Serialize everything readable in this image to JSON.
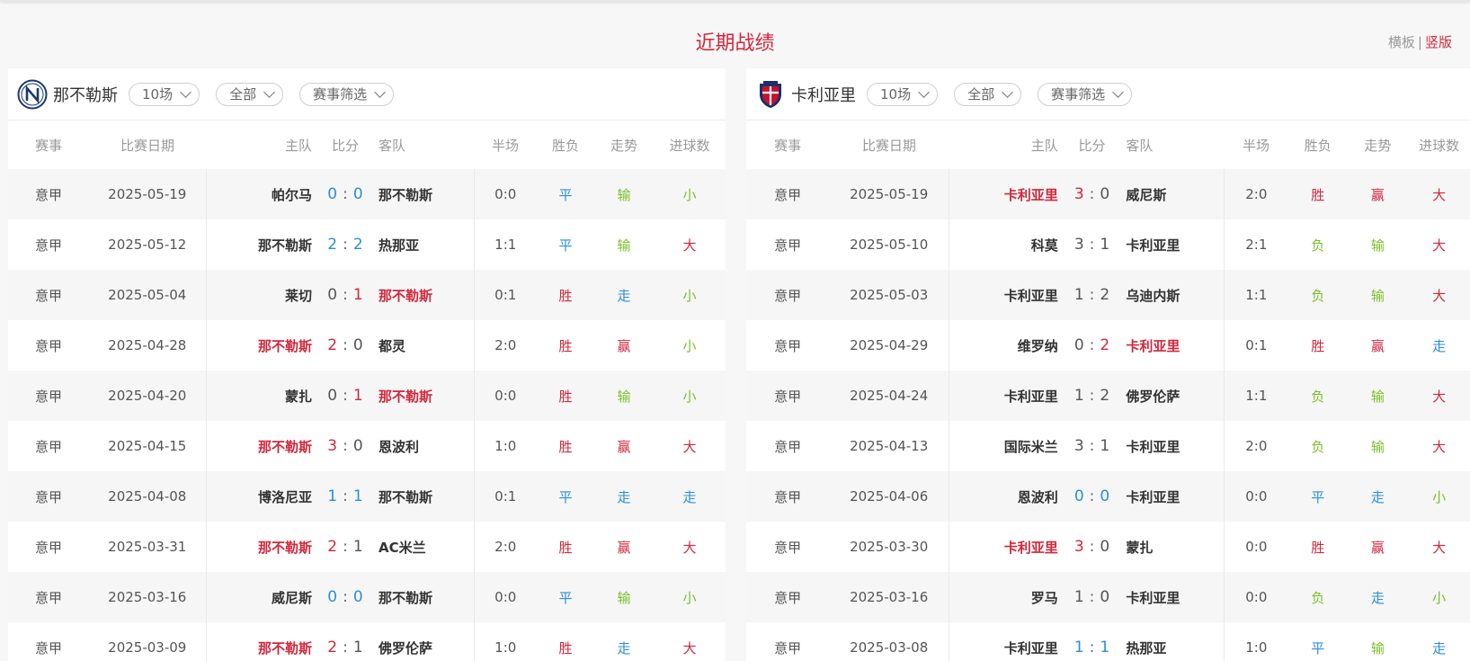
{
  "title": "近期战绩",
  "view": {
    "option1": "横板",
    "separator": "|",
    "option2": "竖版"
  },
  "headers": {
    "league": "赛事",
    "date": "比赛日期",
    "home": "主队",
    "score": "比分",
    "away": "客队",
    "half": "半场",
    "result": "胜负",
    "trend": "走势",
    "goals": "进球数"
  },
  "colors": {
    "win": "#d0283c",
    "draw": "#2a8fd8",
    "lose": "#7bbf2a",
    "neutral": "#555555"
  },
  "panels": [
    {
      "team": "那不勒斯",
      "logo_icon": "napoli-logo-icon",
      "filters": [
        "10场",
        "全部",
        "赛事筛选"
      ],
      "rows": [
        {
          "league": "意甲",
          "date": "2025-05-19",
          "home": "帕尔马",
          "hs": "0",
          "as": "0",
          "away": "那不勒斯",
          "half": "0:0",
          "result": "平",
          "trend": "输",
          "goals": "小",
          "hl": "",
          "sc": [
            "blue",
            "blue"
          ],
          "rc": "blue",
          "tc": "green",
          "gc": "green"
        },
        {
          "league": "意甲",
          "date": "2025-05-12",
          "home": "那不勒斯",
          "hs": "2",
          "as": "2",
          "away": "热那亚",
          "half": "1:1",
          "result": "平",
          "trend": "输",
          "goals": "大",
          "hl": "",
          "sc": [
            "blue",
            "blue"
          ],
          "rc": "blue",
          "tc": "green",
          "gc": "red"
        },
        {
          "league": "意甲",
          "date": "2025-05-04",
          "home": "莱切",
          "hs": "0",
          "as": "1",
          "away": "那不勒斯",
          "half": "0:1",
          "result": "胜",
          "trend": "走",
          "goals": "小",
          "hl": "away",
          "sc": [
            "gray",
            "red"
          ],
          "rc": "red",
          "tc": "blue",
          "gc": "green"
        },
        {
          "league": "意甲",
          "date": "2025-04-28",
          "home": "那不勒斯",
          "hs": "2",
          "as": "0",
          "away": "都灵",
          "half": "2:0",
          "result": "胜",
          "trend": "赢",
          "goals": "小",
          "hl": "home",
          "sc": [
            "red",
            "gray"
          ],
          "rc": "red",
          "tc": "red",
          "gc": "green"
        },
        {
          "league": "意甲",
          "date": "2025-04-20",
          "home": "蒙扎",
          "hs": "0",
          "as": "1",
          "away": "那不勒斯",
          "half": "0:0",
          "result": "胜",
          "trend": "输",
          "goals": "小",
          "hl": "away",
          "sc": [
            "gray",
            "red"
          ],
          "rc": "red",
          "tc": "green",
          "gc": "green"
        },
        {
          "league": "意甲",
          "date": "2025-04-15",
          "home": "那不勒斯",
          "hs": "3",
          "as": "0",
          "away": "恩波利",
          "half": "1:0",
          "result": "胜",
          "trend": "赢",
          "goals": "大",
          "hl": "home",
          "sc": [
            "red",
            "gray"
          ],
          "rc": "red",
          "tc": "red",
          "gc": "red"
        },
        {
          "league": "意甲",
          "date": "2025-04-08",
          "home": "博洛尼亚",
          "hs": "1",
          "as": "1",
          "away": "那不勒斯",
          "half": "0:1",
          "result": "平",
          "trend": "走",
          "goals": "走",
          "hl": "",
          "sc": [
            "blue",
            "blue"
          ],
          "rc": "blue",
          "tc": "blue",
          "gc": "blue"
        },
        {
          "league": "意甲",
          "date": "2025-03-31",
          "home": "那不勒斯",
          "hs": "2",
          "as": "1",
          "away": "AC米兰",
          "half": "2:0",
          "result": "胜",
          "trend": "赢",
          "goals": "大",
          "hl": "home",
          "sc": [
            "red",
            "gray"
          ],
          "rc": "red",
          "tc": "red",
          "gc": "red"
        },
        {
          "league": "意甲",
          "date": "2025-03-16",
          "home": "威尼斯",
          "hs": "0",
          "as": "0",
          "away": "那不勒斯",
          "half": "0:0",
          "result": "平",
          "trend": "输",
          "goals": "小",
          "hl": "",
          "sc": [
            "blue",
            "blue"
          ],
          "rc": "blue",
          "tc": "green",
          "gc": "green"
        },
        {
          "league": "意甲",
          "date": "2025-03-09",
          "home": "那不勒斯",
          "hs": "2",
          "as": "1",
          "away": "佛罗伦萨",
          "half": "1:0",
          "result": "胜",
          "trend": "走",
          "goals": "大",
          "hl": "home",
          "sc": [
            "red",
            "gray"
          ],
          "rc": "red",
          "tc": "blue",
          "gc": "red"
        }
      ]
    },
    {
      "team": "卡利亚里",
      "logo_icon": "cagliari-logo-icon",
      "filters": [
        "10场",
        "全部",
        "赛事筛选"
      ],
      "rows": [
        {
          "league": "意甲",
          "date": "2025-05-19",
          "home": "卡利亚里",
          "hs": "3",
          "as": "0",
          "away": "威尼斯",
          "half": "2:0",
          "result": "胜",
          "trend": "赢",
          "goals": "大",
          "hl": "home",
          "sc": [
            "red",
            "gray"
          ],
          "rc": "red",
          "tc": "red",
          "gc": "red"
        },
        {
          "league": "意甲",
          "date": "2025-05-10",
          "home": "科莫",
          "hs": "3",
          "as": "1",
          "away": "卡利亚里",
          "half": "2:1",
          "result": "负",
          "trend": "输",
          "goals": "大",
          "hl": "",
          "sc": [
            "gray",
            "gray"
          ],
          "rc": "green",
          "tc": "green",
          "gc": "red"
        },
        {
          "league": "意甲",
          "date": "2025-05-03",
          "home": "卡利亚里",
          "hs": "1",
          "as": "2",
          "away": "乌迪内斯",
          "half": "1:1",
          "result": "负",
          "trend": "输",
          "goals": "大",
          "hl": "",
          "sc": [
            "gray",
            "gray"
          ],
          "rc": "green",
          "tc": "green",
          "gc": "red"
        },
        {
          "league": "意甲",
          "date": "2025-04-29",
          "home": "维罗纳",
          "hs": "0",
          "as": "2",
          "away": "卡利亚里",
          "half": "0:1",
          "result": "胜",
          "trend": "赢",
          "goals": "走",
          "hl": "away",
          "sc": [
            "gray",
            "red"
          ],
          "rc": "red",
          "tc": "red",
          "gc": "blue"
        },
        {
          "league": "意甲",
          "date": "2025-04-24",
          "home": "卡利亚里",
          "hs": "1",
          "as": "2",
          "away": "佛罗伦萨",
          "half": "1:1",
          "result": "负",
          "trend": "输",
          "goals": "大",
          "hl": "",
          "sc": [
            "gray",
            "gray"
          ],
          "rc": "green",
          "tc": "green",
          "gc": "red"
        },
        {
          "league": "意甲",
          "date": "2025-04-13",
          "home": "国际米兰",
          "hs": "3",
          "as": "1",
          "away": "卡利亚里",
          "half": "2:0",
          "result": "负",
          "trend": "输",
          "goals": "大",
          "hl": "",
          "sc": [
            "gray",
            "gray"
          ],
          "rc": "green",
          "tc": "green",
          "gc": "red"
        },
        {
          "league": "意甲",
          "date": "2025-04-06",
          "home": "恩波利",
          "hs": "0",
          "as": "0",
          "away": "卡利亚里",
          "half": "0:0",
          "result": "平",
          "trend": "走",
          "goals": "小",
          "hl": "",
          "sc": [
            "blue",
            "blue"
          ],
          "rc": "blue",
          "tc": "blue",
          "gc": "green"
        },
        {
          "league": "意甲",
          "date": "2025-03-30",
          "home": "卡利亚里",
          "hs": "3",
          "as": "0",
          "away": "蒙扎",
          "half": "0:0",
          "result": "胜",
          "trend": "赢",
          "goals": "大",
          "hl": "home",
          "sc": [
            "red",
            "gray"
          ],
          "rc": "red",
          "tc": "red",
          "gc": "red"
        },
        {
          "league": "意甲",
          "date": "2025-03-16",
          "home": "罗马",
          "hs": "1",
          "as": "0",
          "away": "卡利亚里",
          "half": "0:0",
          "result": "负",
          "trend": "走",
          "goals": "小",
          "hl": "",
          "sc": [
            "gray",
            "gray"
          ],
          "rc": "green",
          "tc": "blue",
          "gc": "green"
        },
        {
          "league": "意甲",
          "date": "2025-03-08",
          "home": "卡利亚里",
          "hs": "1",
          "as": "1",
          "away": "热那亚",
          "half": "1:0",
          "result": "平",
          "trend": "输",
          "goals": "走",
          "hl": "",
          "sc": [
            "blue",
            "blue"
          ],
          "rc": "blue",
          "tc": "green",
          "gc": "blue"
        }
      ]
    }
  ]
}
